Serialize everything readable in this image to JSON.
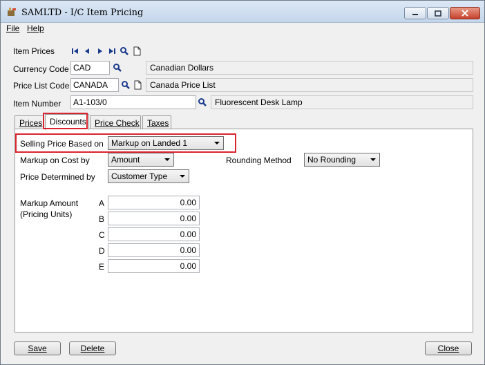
{
  "window": {
    "title": "SAMLTD - I/C Item Pricing"
  },
  "menu": {
    "file": "File",
    "help": "Help"
  },
  "header": {
    "item_prices_label": "Item Prices",
    "currency_code_label": "Currency Code",
    "currency_code_value": "CAD",
    "currency_desc": "Canadian Dollars",
    "price_list_code_label": "Price List Code",
    "price_list_code_value": "CANADA",
    "price_list_desc": "Canada Price List",
    "item_number_label": "Item Number",
    "item_number_value": "A1-103/0",
    "item_desc": "Fluorescent Desk Lamp"
  },
  "tabs": [
    {
      "label": "Prices"
    },
    {
      "label": "Discounts"
    },
    {
      "label": "Price Check"
    },
    {
      "label": "Taxes"
    }
  ],
  "discounts": {
    "selling_price_based_on_label": "Selling Price Based on",
    "selling_price_based_on_value": "Markup on Landed 1",
    "markup_on_cost_by_label": "Markup on Cost by",
    "markup_on_cost_by_value": "Amount",
    "rounding_method_label": "Rounding Method",
    "rounding_method_value": "No Rounding",
    "price_determined_by_label": "Price Determined by",
    "price_determined_by_value": "Customer Type",
    "markup_amount_label": "Markup Amount",
    "pricing_units_label": "(Pricing Units)",
    "levels": [
      {
        "letter": "A",
        "value": "0.00"
      },
      {
        "letter": "B",
        "value": "0.00"
      },
      {
        "letter": "C",
        "value": "0.00"
      },
      {
        "letter": "D",
        "value": "0.00"
      },
      {
        "letter": "E",
        "value": "0.00"
      }
    ]
  },
  "buttons": {
    "save": "Save",
    "delete": "Delete",
    "close": "Close"
  },
  "colors": {
    "highlight": "#d9232e",
    "nav_icon": "#1a3a8a"
  }
}
